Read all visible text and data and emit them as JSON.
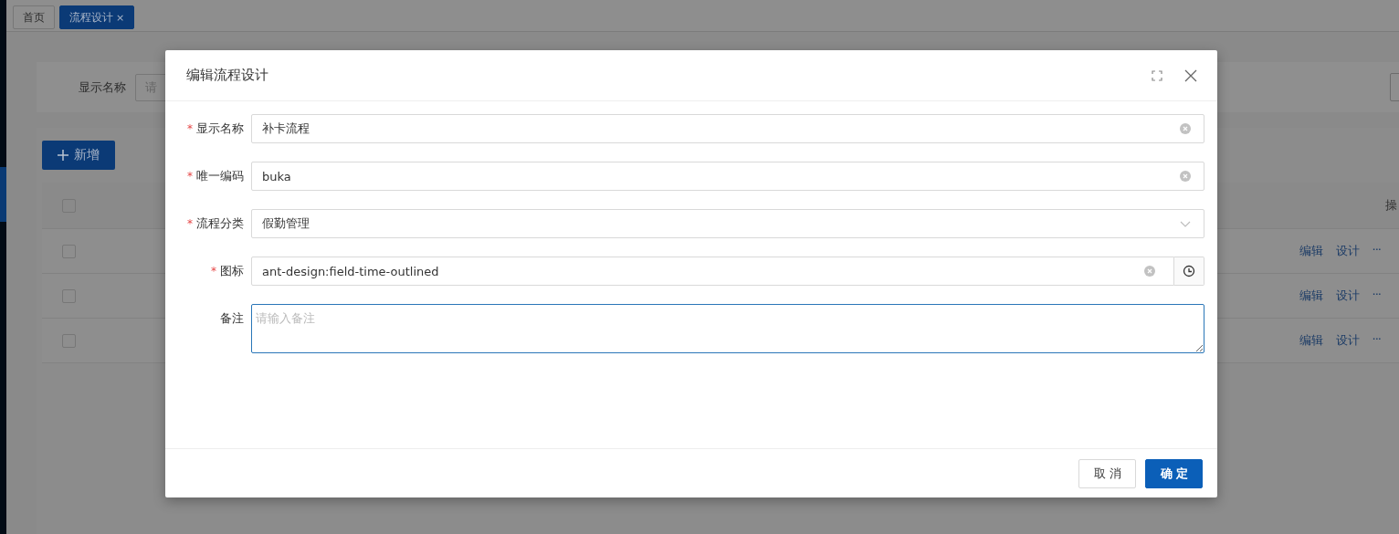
{
  "tabs": [
    {
      "label": "首页",
      "selected": false
    },
    {
      "label": "流程设计",
      "selected": true,
      "close": "×"
    }
  ],
  "search": {
    "label": "显示名称",
    "placeholder": "请"
  },
  "add_button": {
    "label": "新增"
  },
  "table": {
    "header": {
      "checked": false,
      "actions_label": "操"
    },
    "rows": [
      {
        "checked": false,
        "actions": [
          "编辑",
          "设计",
          "···"
        ]
      },
      {
        "checked": false,
        "actions": [
          "编辑",
          "设计",
          "···"
        ]
      },
      {
        "checked": false,
        "actions": [
          "编辑",
          "设计",
          "···"
        ]
      }
    ]
  },
  "dialog": {
    "title": "编辑流程设计",
    "fields": [
      {
        "kind": "input",
        "required_mark": "*",
        "label": "显示名称",
        "value": "补卡流程",
        "clearable": true
      },
      {
        "kind": "input",
        "required_mark": "*",
        "label": "唯一编码",
        "value": "buka",
        "clearable": true
      },
      {
        "kind": "select",
        "required_mark": "*",
        "label": "流程分类",
        "value": "假勤管理"
      },
      {
        "kind": "icon-picker",
        "required_mark": "*",
        "label": "图标",
        "value": "ant-design:field-time-outlined",
        "clearable": true
      },
      {
        "kind": "textarea",
        "label": "备注",
        "placeholder": "请输入备注",
        "focused": true
      }
    ],
    "buttons": [
      {
        "label": "取消",
        "primary": false
      },
      {
        "label": "确定",
        "primary": true
      }
    ]
  }
}
